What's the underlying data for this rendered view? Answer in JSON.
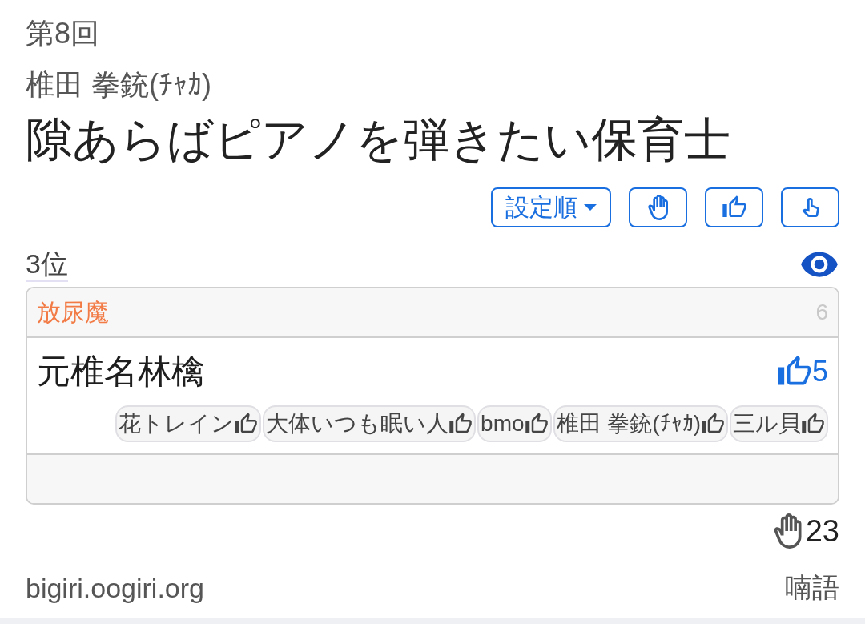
{
  "round": "第8回",
  "author": "椎田 拳銃(ﾁｬｶ)",
  "title": "隙あらばピアノを弾きたい保育士",
  "toolbar": {
    "sort": {
      "label": "設定順"
    }
  },
  "rank": "3位",
  "answer": {
    "author": "放尿魔",
    "score": "6",
    "text": "元椎名林檎",
    "likes": "5",
    "voters": [
      "花トレイン",
      "大体いつも眠い人",
      "bmo",
      "椎田 拳銃(ﾁｬｶ)",
      "三ル貝"
    ]
  },
  "hands": "23",
  "footer": {
    "site": "bigiri.oogiri.org",
    "user": "喃語"
  }
}
